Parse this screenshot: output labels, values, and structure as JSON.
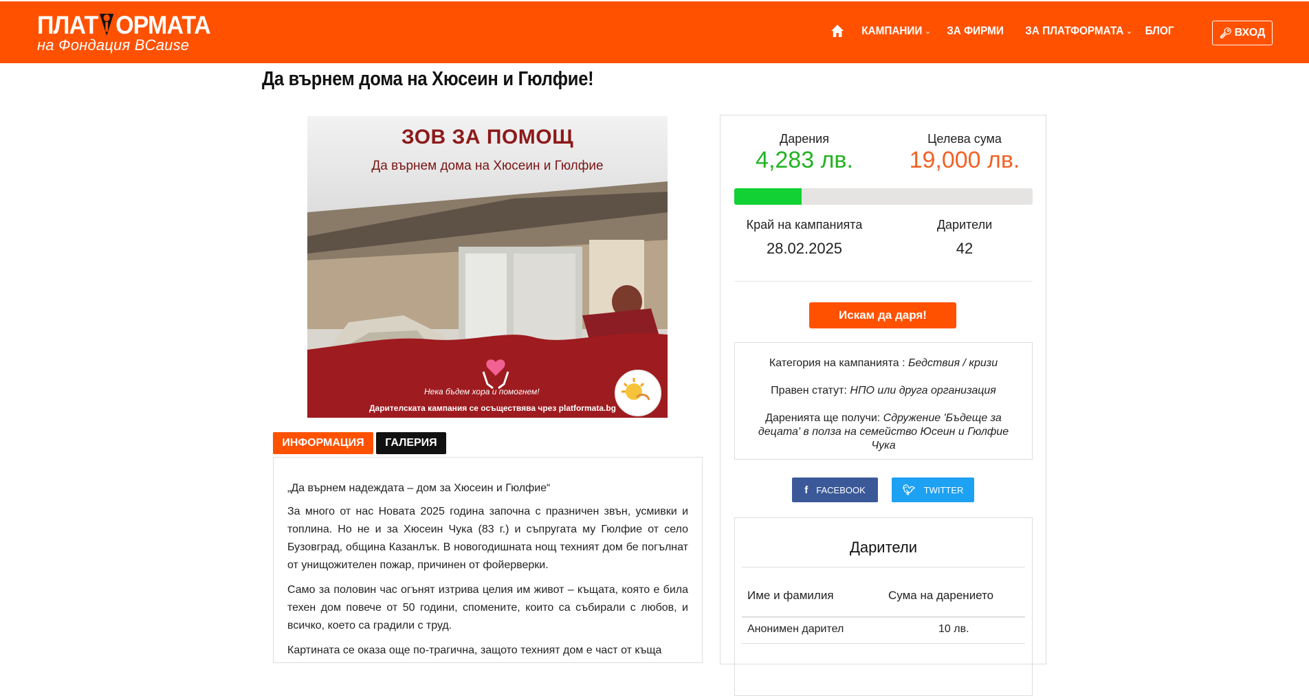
{
  "header": {
    "logo_main_left": "ПЛАТ",
    "logo_main_right": "ОРМАТА",
    "logo_sub": "на Фондация BCause",
    "nav": {
      "campaigns": "КАМПАНИИ",
      "for_companies": "ЗА ФИРМИ",
      "about": "ЗА ПЛАТФОРМАТА",
      "blog": "БЛОГ"
    },
    "login": "ВХОД"
  },
  "page_title": "Да върнем дома на Хюсеин и Гюлфие!",
  "poster": {
    "heading": "ЗОВ ЗА ПОМОЩ",
    "subheading": "Да върнем дома на Хюсеин и Гюлфие",
    "footer_line1": "Нека бъдем хора и помогнем!",
    "footer_line2": "Дарителската кампания се осъществява чрез platformata.bg"
  },
  "tabs": {
    "info": "ИНФОРМАЦИЯ",
    "gallery": "ГАЛЕРИЯ"
  },
  "article": {
    "lead": "„Да върнем надеждата – дом за Хюсеин и Гюлфие“",
    "paragraphs": [
      "За много от нас Новата 2025 година започна с празничен звън, усмивки и топлина. Но не и за Хюсеин Чука (83 г.) и съпругата му Гюлфие от село Бузовград, община Казанлък. В новогодишната нощ техният дом бе погълнат от унищожителен пожар, причинен от фойерверки.",
      "Само за половин час огънят изтрива целия им живот – къщата, която е била техен дом повече от 50 години, спомените, които са събирали с любов, и всичко, което са градили с труд.",
      "Картината се оказа още по-трагична, защото техният дом е част от къща"
    ]
  },
  "stats": {
    "donations_label": "Дарения",
    "donations_value": "4,283  лв.",
    "goal_label": "Целева сума",
    "goal_value": "19,000  лв.",
    "progress_fraction": 0.2254,
    "end_label": "Край на кампанията",
    "end_value": "28.02.2025",
    "donors_label": "Дарители",
    "donors_value": "42"
  },
  "donate_button": "Искам да даря!",
  "info_card": {
    "category_label": "Категория на кампанията : ",
    "category_value": "Бедствия / кризи",
    "status_label": "Правен статут: ",
    "status_value": "НПО или друга организация",
    "recipient_label": "Даренията ще получи: ",
    "recipient_value": "Сдружение 'Бъдеще за децата' в полза на семейство Юсеин и Гюлфие Чука"
  },
  "social": {
    "facebook": "FACEBOOK",
    "twitter": "TWITTER"
  },
  "donors_table": {
    "title": "Дарители",
    "col_name": "Име и фамилия",
    "col_amount": "Сума на дарението",
    "rows": [
      {
        "name": "Анонимен дарител",
        "amount": "10  лв."
      }
    ]
  },
  "colors": {
    "brand_orange": "#ff5100",
    "progress_green": "#11d135",
    "donations_green": "#22b322",
    "goal_orange": "#f26224"
  }
}
